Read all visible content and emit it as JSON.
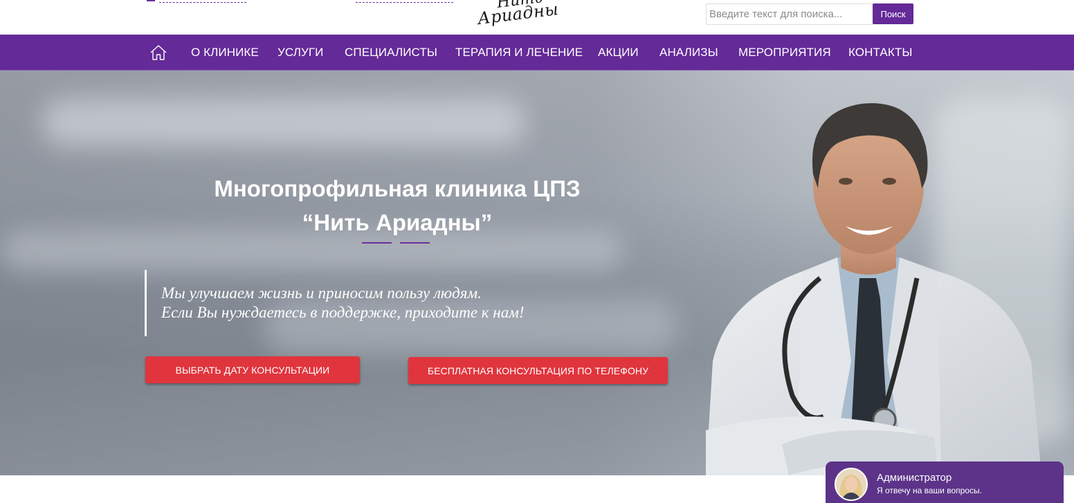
{
  "header": {
    "logo_line1": "Нить",
    "logo_line2": "Ариадны",
    "search": {
      "placeholder": "Введите текст для поиска...",
      "button_label": "Поиск"
    }
  },
  "nav": {
    "home_icon": "home-icon",
    "items": [
      {
        "label": "О КЛИНИКЕ"
      },
      {
        "label": "УСЛУГИ"
      },
      {
        "label": "СПЕЦИАЛИСТЫ"
      },
      {
        "label": "ТЕРАПИЯ И ЛЕЧЕНИЕ"
      },
      {
        "label": "АКЦИИ"
      },
      {
        "label": "АНАЛИЗЫ"
      },
      {
        "label": "МЕРОПРИЯТИЯ"
      },
      {
        "label": "КОНТАКТЫ"
      }
    ]
  },
  "hero": {
    "title_line1": "Многопрофильная клиника ЦПЗ",
    "title_line2": "“Нить Ариадны”",
    "quote_line1": "Мы улучшаем жизнь и приносим пользу людям.",
    "quote_line2": "Если Вы нуждаетесь в поддержке, приходите к нам!",
    "button_primary": "ВЫБРАТЬ ДАТУ КОНСУЛЬТАЦИИ",
    "button_secondary": "БЕСПЛАТНАЯ КОНСУЛЬТАЦИЯ ПО ТЕЛЕФОНУ"
  },
  "chat": {
    "name": "Администратор",
    "subtitle": "Я отвечу на ваши вопросы."
  },
  "colors": {
    "brand_purple": "#642a98",
    "accent_red": "#e0353d",
    "chat_purple": "#5c3388"
  }
}
